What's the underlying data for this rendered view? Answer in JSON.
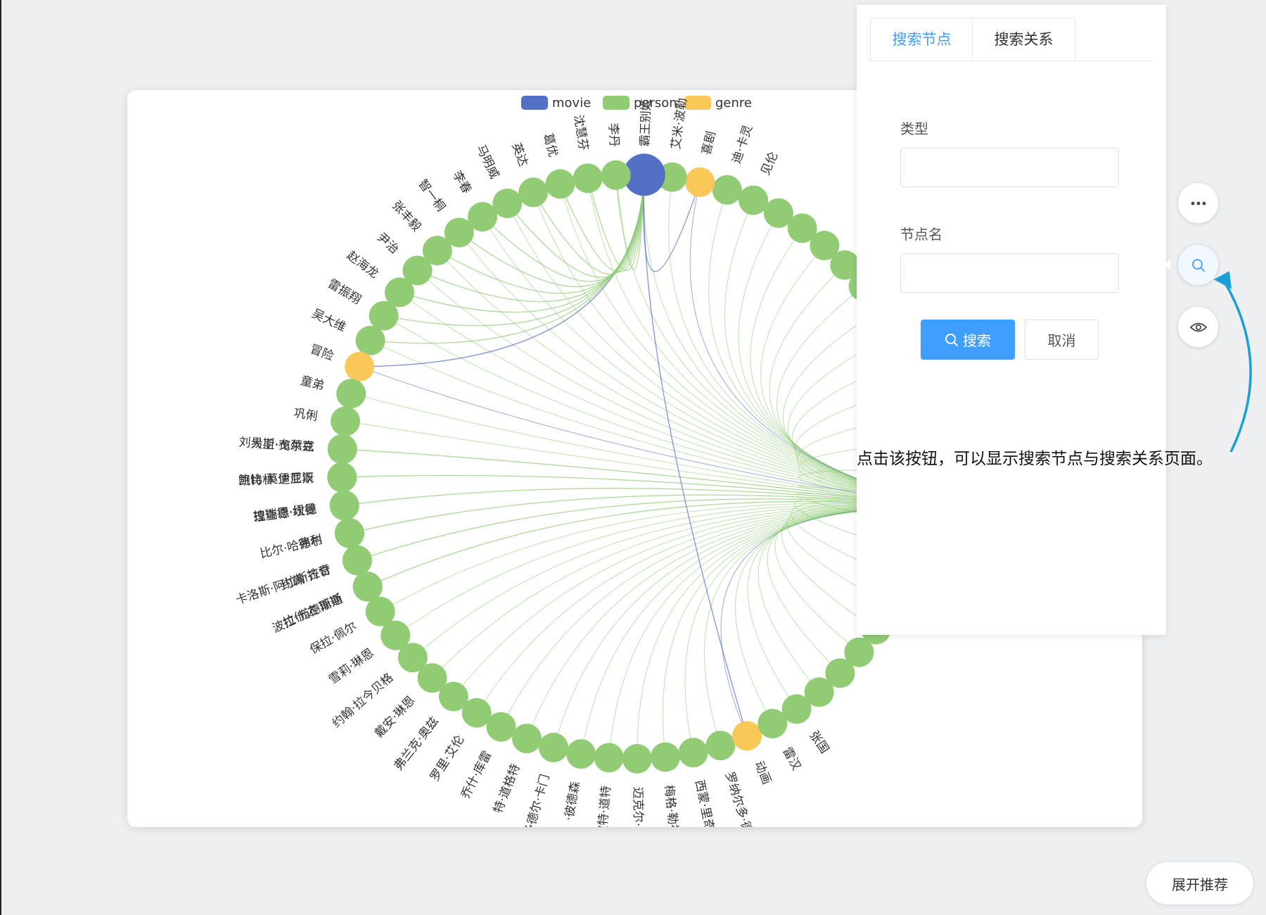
{
  "chart_data": {
    "type": "graph",
    "layout": "circular",
    "legend": [
      {
        "name": "movie",
        "color": "#5470c6"
      },
      {
        "name": "person",
        "color": "#91cc75"
      },
      {
        "name": "genre",
        "color": "#fac858"
      }
    ],
    "legend_position": "top-center",
    "labels_start_angle_deg": -176.5,
    "labels_step_deg": -5.54,
    "labels": [
      {
        "name": "刘易斯·布莱克",
        "category": "person"
      },
      {
        "name": "鲍比·莫伊尼汉",
        "category": "person"
      },
      {
        "name": "拉瑞恩·纽曼",
        "category": "person"
      },
      {
        "name": "弗利",
        "category": "person"
      },
      {
        "name": "卡洛斯·阿拉斯拉奇",
        "category": "person"
      },
      {
        "name": "拉什达·琼斯",
        "category": "person"
      },
      {
        "name": "保拉·佩尔",
        "category": "person"
      },
      {
        "name": "雪莉·琳恩",
        "category": "person"
      },
      {
        "name": "约翰·拉今贝格",
        "category": "person"
      },
      {
        "name": "戴安·琳恩",
        "category": "person"
      },
      {
        "name": "弗兰克·奥兹",
        "category": "person"
      },
      {
        "name": "罗里·艾伦",
        "category": "person"
      },
      {
        "name": "乔什·库雷",
        "category": "person"
      },
      {
        "name": "特·道格特",
        "category": "person"
      },
      {
        "name": "多德尔·卡门",
        "category": "person"
      },
      {
        "name": "·彼德森",
        "category": "person"
      },
      {
        "name": "彼特·道特",
        "category": "person"
      },
      {
        "name": "迈克尔·阿恩",
        "category": "person"
      },
      {
        "name": "梅格·勒福夫",
        "category": "person"
      },
      {
        "name": "西蒙·里奇",
        "category": "person"
      },
      {
        "name": "罗纳尔多·德尔·卡",
        "category": "person"
      },
      {
        "name": "动画",
        "category": "genre"
      },
      {
        "name": "雷汉",
        "category": "person"
      },
      {
        "name": "张国",
        "category": "person"
      },
      {
        "name": "",
        "category": "person"
      },
      {
        "name": "",
        "category": "person"
      },
      {
        "name": "",
        "category": "person"
      },
      {
        "name": "",
        "category": "person"
      },
      {
        "name": "",
        "category": "person"
      },
      {
        "name": "",
        "category": "person"
      },
      {
        "name": "",
        "category": "person"
      },
      {
        "name": "",
        "category": "person"
      },
      {
        "name": "",
        "category": "person"
      },
      {
        "name": "",
        "category": "person"
      },
      {
        "name": "",
        "category": "person"
      },
      {
        "name": "",
        "category": "person"
      },
      {
        "name": "",
        "category": "person"
      },
      {
        "name": "",
        "category": "person"
      },
      {
        "name": "",
        "category": "person"
      },
      {
        "name": "",
        "category": "person"
      },
      {
        "name": "",
        "category": "person"
      },
      {
        "name": "",
        "category": "person"
      },
      {
        "name": "",
        "category": "person"
      },
      {
        "name": "",
        "category": "person"
      },
      {
        "name": "",
        "category": "person"
      },
      {
        "name": "见伦",
        "category": "person"
      },
      {
        "name": "迪·卡灵",
        "category": "person"
      },
      {
        "name": "喜剧",
        "category": "genre"
      },
      {
        "name": "艾米·波勒",
        "category": "person"
      },
      {
        "name": "霸王别姬",
        "category": "movie"
      },
      {
        "name": "李丹",
        "category": "person"
      },
      {
        "name": "沈慧芬",
        "category": "person"
      },
      {
        "name": "葛优",
        "category": "person"
      },
      {
        "name": "英达",
        "category": "person"
      },
      {
        "name": "马明威",
        "category": "person"
      },
      {
        "name": "李春",
        "category": "person"
      },
      {
        "name": "智一桐",
        "category": "person"
      },
      {
        "name": "张丰毅",
        "category": "person"
      },
      {
        "name": "尹治",
        "category": "person"
      },
      {
        "name": "赵海龙",
        "category": "person"
      },
      {
        "name": "雷振翔",
        "category": "person"
      },
      {
        "name": "吴大维",
        "category": "person"
      },
      {
        "name": "冒险",
        "category": "genre"
      },
      {
        "name": "童弟",
        "category": "person"
      },
      {
        "name": "巩俐",
        "category": "person"
      },
      {
        "name": "大卫·戈尔兹",
        "category": "person"
      },
      {
        "name": "凯特林·迪亚斯",
        "category": "person"
      },
      {
        "name": "理查德·坎德",
        "category": "person"
      },
      {
        "name": "比尔·哈德尔",
        "category": "person"
      },
      {
        "name": "约翰·齐甘",
        "category": "person"
      },
      {
        "name": "波拉·庞德斯通",
        "category": "person"
      }
    ],
    "links": [
      {
        "source": "霸王别姬",
        "target": "冒险"
      },
      {
        "source": "霸王别姬",
        "target": "喜剧"
      },
      {
        "source": "霸王别姬",
        "target": "动画"
      },
      {
        "source": "霸王别姬",
        "target": "李丹"
      },
      {
        "source": "霸王别姬",
        "target": "沈慧芬"
      },
      {
        "source": "霸王别姬",
        "target": "葛优"
      },
      {
        "source": "霸王别姬",
        "target": "英达"
      },
      {
        "source": "霸王别姬",
        "target": "马明威"
      },
      {
        "source": "霸王别姬",
        "target": "李春"
      },
      {
        "source": "霸王别姬",
        "target": "智一桐"
      },
      {
        "source": "霸王别姬",
        "target": "张丰毅"
      },
      {
        "source": "霸王别姬",
        "target": "尹治"
      },
      {
        "source": "霸王别姬",
        "target": "赵海龙"
      },
      {
        "source": "霸王别姬",
        "target": "雷振翔"
      },
      {
        "source": "霸王别姬",
        "target": "吴大维"
      }
    ]
  },
  "search_panel": {
    "tabs": [
      "搜索节点",
      "搜索关系"
    ],
    "active_tab": 0,
    "type_label": "类型",
    "type_value": "",
    "type_placeholder": "",
    "name_label": "节点名",
    "name_value": "",
    "name_placeholder": "",
    "search_button": "搜索",
    "cancel_button": "取消"
  },
  "side_buttons": {
    "more_icon": "ellipsis-icon",
    "search_icon": "search-icon",
    "view_icon": "eye-icon"
  },
  "annotation": {
    "text": "点击该按钮，可以显示搜索节点与搜索关系页面。",
    "arrow_color": "#1a9fd8"
  },
  "expand_button": "展开推荐",
  "colors": {
    "primary": "#409eff",
    "movie": "#5470c6",
    "person": "#91cc75",
    "genre": "#fac858"
  }
}
